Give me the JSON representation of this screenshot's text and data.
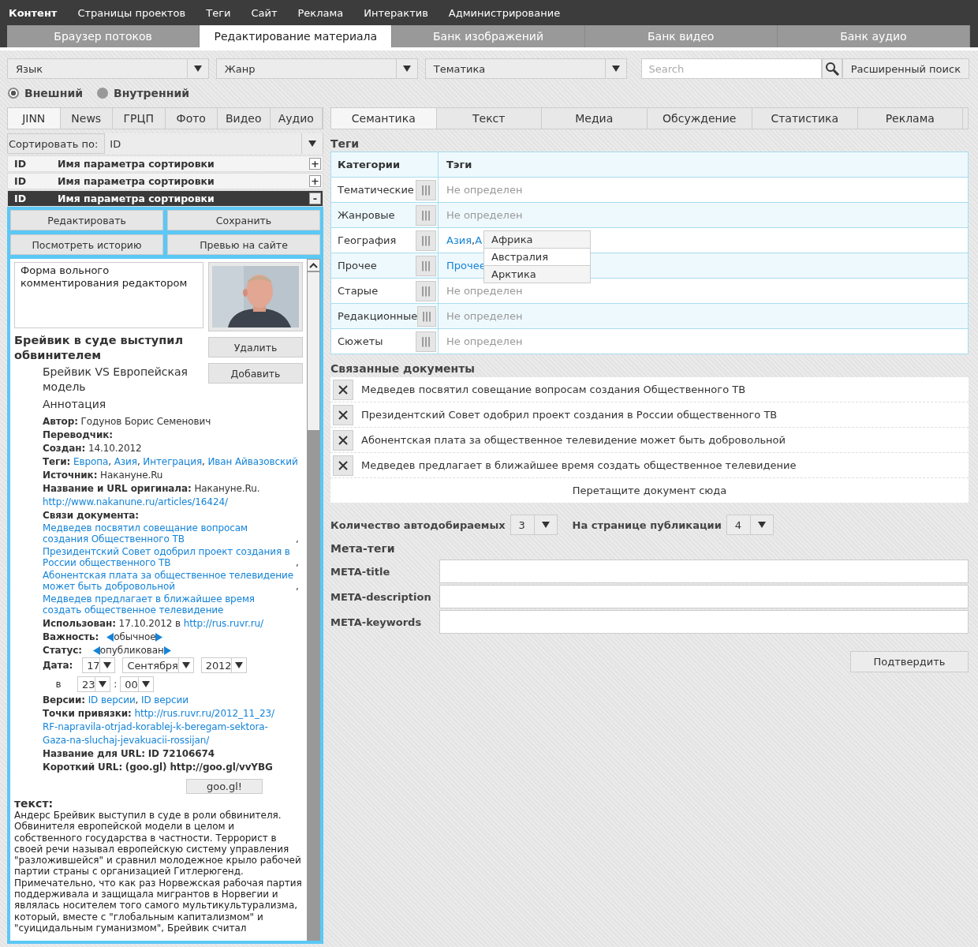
{
  "top_menu": [
    {
      "label": "Контент",
      "selected": true
    },
    {
      "label": "Страницы проектов",
      "selected": false
    },
    {
      "label": "Теги",
      "selected": false
    },
    {
      "label": "Сайт",
      "selected": false
    },
    {
      "label": "Реклама",
      "selected": false
    },
    {
      "label": "Интерактив",
      "selected": false
    },
    {
      "label": "Администрирование",
      "selected": false
    }
  ],
  "sections": [
    {
      "label": "Браузер потоков",
      "selected": false
    },
    {
      "label": "Редактирование материала",
      "selected": true
    },
    {
      "label": "Банк изображений",
      "selected": false
    },
    {
      "label": "Банк видео",
      "selected": false
    },
    {
      "label": "Банк аудио",
      "selected": false
    }
  ],
  "filters": {
    "selects": [
      "Язык",
      "Жанр",
      "Тематика"
    ],
    "search": {
      "placeholder": "Search"
    },
    "advanced_button": "Расширенный поиск"
  },
  "source": [
    {
      "label": "Внешний",
      "selected": true
    },
    {
      "label": "Внутренний",
      "selected": false
    }
  ],
  "left": {
    "tabs": [
      {
        "label": "JINN",
        "selected": true
      },
      {
        "label": "News",
        "selected": false
      },
      {
        "label": "ГРЦП",
        "selected": false
      },
      {
        "label": "Фото",
        "selected": false
      },
      {
        "label": "Видео",
        "selected": false
      },
      {
        "label": "Аудио",
        "selected": false
      }
    ],
    "sort": {
      "label": "Сортировать по:",
      "value": "ID"
    },
    "rows": [
      {
        "id": "ID",
        "name": "Имя параметра сортировки",
        "toggle": "+",
        "expanded": false
      },
      {
        "id": "ID",
        "name": "Имя параметра сортировки",
        "toggle": "+",
        "expanded": false
      },
      {
        "id": "ID",
        "name": "Имя параметра сортировки",
        "toggle": "-",
        "expanded": true
      }
    ],
    "actions": [
      "Редактировать",
      "Сохранить",
      "Посмотреть историю",
      "Превью на сайте"
    ],
    "comment": "Форма вольного комментирования редактором",
    "image": {
      "kind": "picture",
      "buttons": [
        "Удалить",
        "Добавить"
      ]
    },
    "title": "Брейвик в суде выступил обвинителем",
    "subtitle": "Брейвик VS Европейская модель",
    "annotation": "Аннотация",
    "meta": [
      {
        "kind": "text",
        "label": "Автор:",
        "value": "Годунов Борис Семенович"
      },
      {
        "kind": "text",
        "label": "Переводчик:"
      },
      {
        "kind": "text",
        "label": "Создан:",
        "value": "14.10.2012"
      },
      {
        "kind": "links",
        "label": "Теги:",
        "separator": ",",
        "links": [
          "Европа",
          "Азия",
          "Интеграция",
          "Иван Айвазовский"
        ]
      },
      {
        "kind": "text",
        "label": "Источник:",
        "value": "Накануне.Ru"
      },
      {
        "kind": "text",
        "label": "Название и URL оригинала:",
        "value": "Накануне.Ru.",
        "link": "http://www.nakanune.ru/articles/16424/"
      },
      {
        "kind": "links",
        "label": "Связи документа:",
        "separator": ",",
        "links": [
          "Медведев посвятил совещание вопросам создания Общественного ТВ",
          "Президентский Совет одобрил проект создания в России общественного ТВ",
          "Абонентская плата за общественное телевидение может быть добровольной",
          "Медведев предлагает в ближайшее время создать общественное телевидение"
        ]
      },
      {
        "kind": "text",
        "label": "Использован:",
        "value": "17.10.2012 в",
        "link": "http://rus.ruvr.ru/"
      },
      {
        "kind": "switch",
        "label": "Важность:",
        "value": "обычное"
      },
      {
        "kind": "switch",
        "label": "Статус:",
        "value": "опубликован"
      },
      {
        "kind": "date",
        "label": "Дата:",
        "parts": [
          "17",
          "Сентября",
          "2012"
        ]
      },
      {
        "kind": "time",
        "label": "в",
        "parts": [
          "23",
          "00"
        ],
        "separator": ":"
      },
      {
        "kind": "links",
        "label": "Версии:",
        "separator": ",",
        "links": [
          "ID версии",
          "ID версии"
        ]
      },
      {
        "kind": "lines",
        "label": "Точки привязки:",
        "lines": [
          "http://rus.ruvr.ru/2012_11_23/",
          "RF-napravila-otrjad-korablej-k-beregam-sektora-",
          "Gaza-na-sluchaj-jevakuacii-rossijan/"
        ]
      },
      {
        "kind": "bold",
        "label": "Название для URL:",
        "value": "ID 72106674"
      },
      {
        "kind": "bold",
        "label": "Короткий URL:",
        "value": "(goo.gl) http://goo.gl/vvYBG"
      }
    ],
    "shorten_button": "goo.gl!",
    "text_heading": "текст:",
    "text": "Андерс Брейвик выступил в суде в роли обвинителя. Обвинителя европейской модели в целом и собственного государства в частности. Террорист в своей речи называл европейскую систему управления \"разложившейся\" и сравнил молодежное крыло рабочей партии страны с организацией Гитлерюгенд. Примечательно, что как раз Норвежская рабочая партия поддерживала и защищала мигрантов в Норвегии и являлась носителем того самого мультикультурализма, который, вместе с \"глобальным капитализмом\" и \"суицидальным гуманизмом\", Брейвик считал"
  },
  "right": {
    "tabs": [
      {
        "label": "Семантика",
        "selected": true
      },
      {
        "label": "Текст",
        "selected": false
      },
      {
        "label": "Медиа",
        "selected": false
      },
      {
        "label": "Обсуждение",
        "selected": false
      },
      {
        "label": "Статистика",
        "selected": false
      },
      {
        "label": "Реклама",
        "selected": false
      }
    ],
    "tags": {
      "heading": "Теги",
      "columns": [
        "Категории",
        "Тэги"
      ],
      "rows": [
        {
          "category": "Тематические",
          "picker": "|||",
          "value": "Не определен"
        },
        {
          "category": "Жанровые",
          "picker": "|||",
          "value": "Не определен"
        },
        {
          "category": "География",
          "picker": "|||",
          "tags": [
            "Азия",
            "А"
          ],
          "separator": ",",
          "menu": [
            "Африка",
            "Австралия",
            "Арктика"
          ]
        },
        {
          "category": "Прочее",
          "picker": "|||",
          "tags": [
            "Прочее"
          ]
        },
        {
          "category": "Старые",
          "picker": "|||",
          "value": "Не определен"
        },
        {
          "category": "Редакционные",
          "picker": "|||",
          "value": "Не определен"
        },
        {
          "category": "Сюжеты",
          "picker": "|||",
          "value": "Не определен"
        }
      ]
    },
    "related": {
      "heading": "Связанные документы",
      "items": [
        "Медведев посвятил совещание вопросам создания Общественного ТВ",
        "Президентский Совет одобрил проект создания в России общественного ТВ",
        "Абонентская плата за общественное телевидение может быть добровольной",
        "Медведев предлагает в ближайшее время создать общественное телевидение"
      ],
      "drop_hint": "Перетащите документ сюда"
    },
    "counts": [
      {
        "label": "Количество автодобираемых",
        "value": "3"
      },
      {
        "label": "На странице публикации",
        "value": "4"
      }
    ],
    "meta_tags": {
      "heading": "Мета-теги",
      "fields": [
        "META-title",
        "META-description",
        "META-keywords"
      ]
    },
    "confirm_button": "Подтвердить"
  }
}
